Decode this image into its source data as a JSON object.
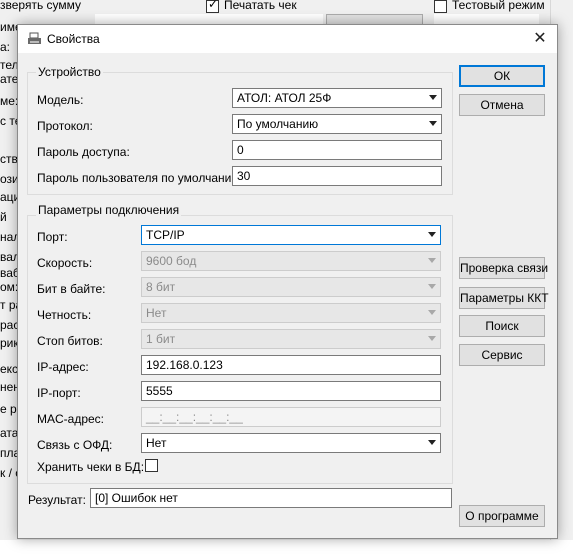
{
  "background": {
    "top_texts": [
      "зверять сумму",
      "Печатать чек",
      "Тестовый режим"
    ],
    "left_fragments": [
      "имен",
      "а:",
      "тел",
      "ате",
      "ме:",
      "с те",
      "ство",
      "ози",
      "ация",
      "й",
      "нал",
      "вало",
      "вабо",
      "ом:",
      "т ра",
      "рас",
      "рик",
      "ексе",
      "нен",
      "е р",
      "ата",
      "пла",
      "к / с"
    ]
  },
  "dialog": {
    "title": "Свойства",
    "close_label": "✕",
    "device_group": {
      "legend": "Устройство",
      "model_label": "Модель:",
      "model_value": "АТОЛ: АТОЛ 25Ф",
      "protocol_label": "Протокол:",
      "protocol_value": "По умолчанию",
      "password_label": "Пароль доступа:",
      "password_value": "0",
      "user_password_label": "Пароль пользователя по умолчанию:",
      "user_password_value": "30"
    },
    "connection_group": {
      "legend": "Параметры подключения",
      "port_label": "Порт:",
      "port_value": "TCP/IP",
      "speed_label": "Скорость:",
      "speed_value": "9600 бод",
      "bits_label": "Бит в байте:",
      "bits_value": "8 бит",
      "parity_label": "Четность:",
      "parity_value": "Нет",
      "stopbits_label": "Стоп битов:",
      "stopbits_value": "1 бит",
      "ip_label": "IP-адрес:",
      "ip_value": "192.168.0.123",
      "ipport_label": "IP-порт:",
      "ipport_value": "5555",
      "mac_label": "MAC-адрес:",
      "mac_value": "__:__:__:__:__:__",
      "ofd_label": "Связь с ОФД:",
      "ofd_value": "Нет",
      "store_label": "Хранить чеки в БД:"
    },
    "result_label": "Результат:",
    "result_value": "[0] Ошибок нет",
    "buttons": {
      "ok": "ОК",
      "cancel": "Отмена",
      "check_connection": "Проверка связи",
      "kkt_params": "Параметры ККТ",
      "search": "Поиск",
      "service": "Сервис",
      "about": "О программе"
    }
  }
}
